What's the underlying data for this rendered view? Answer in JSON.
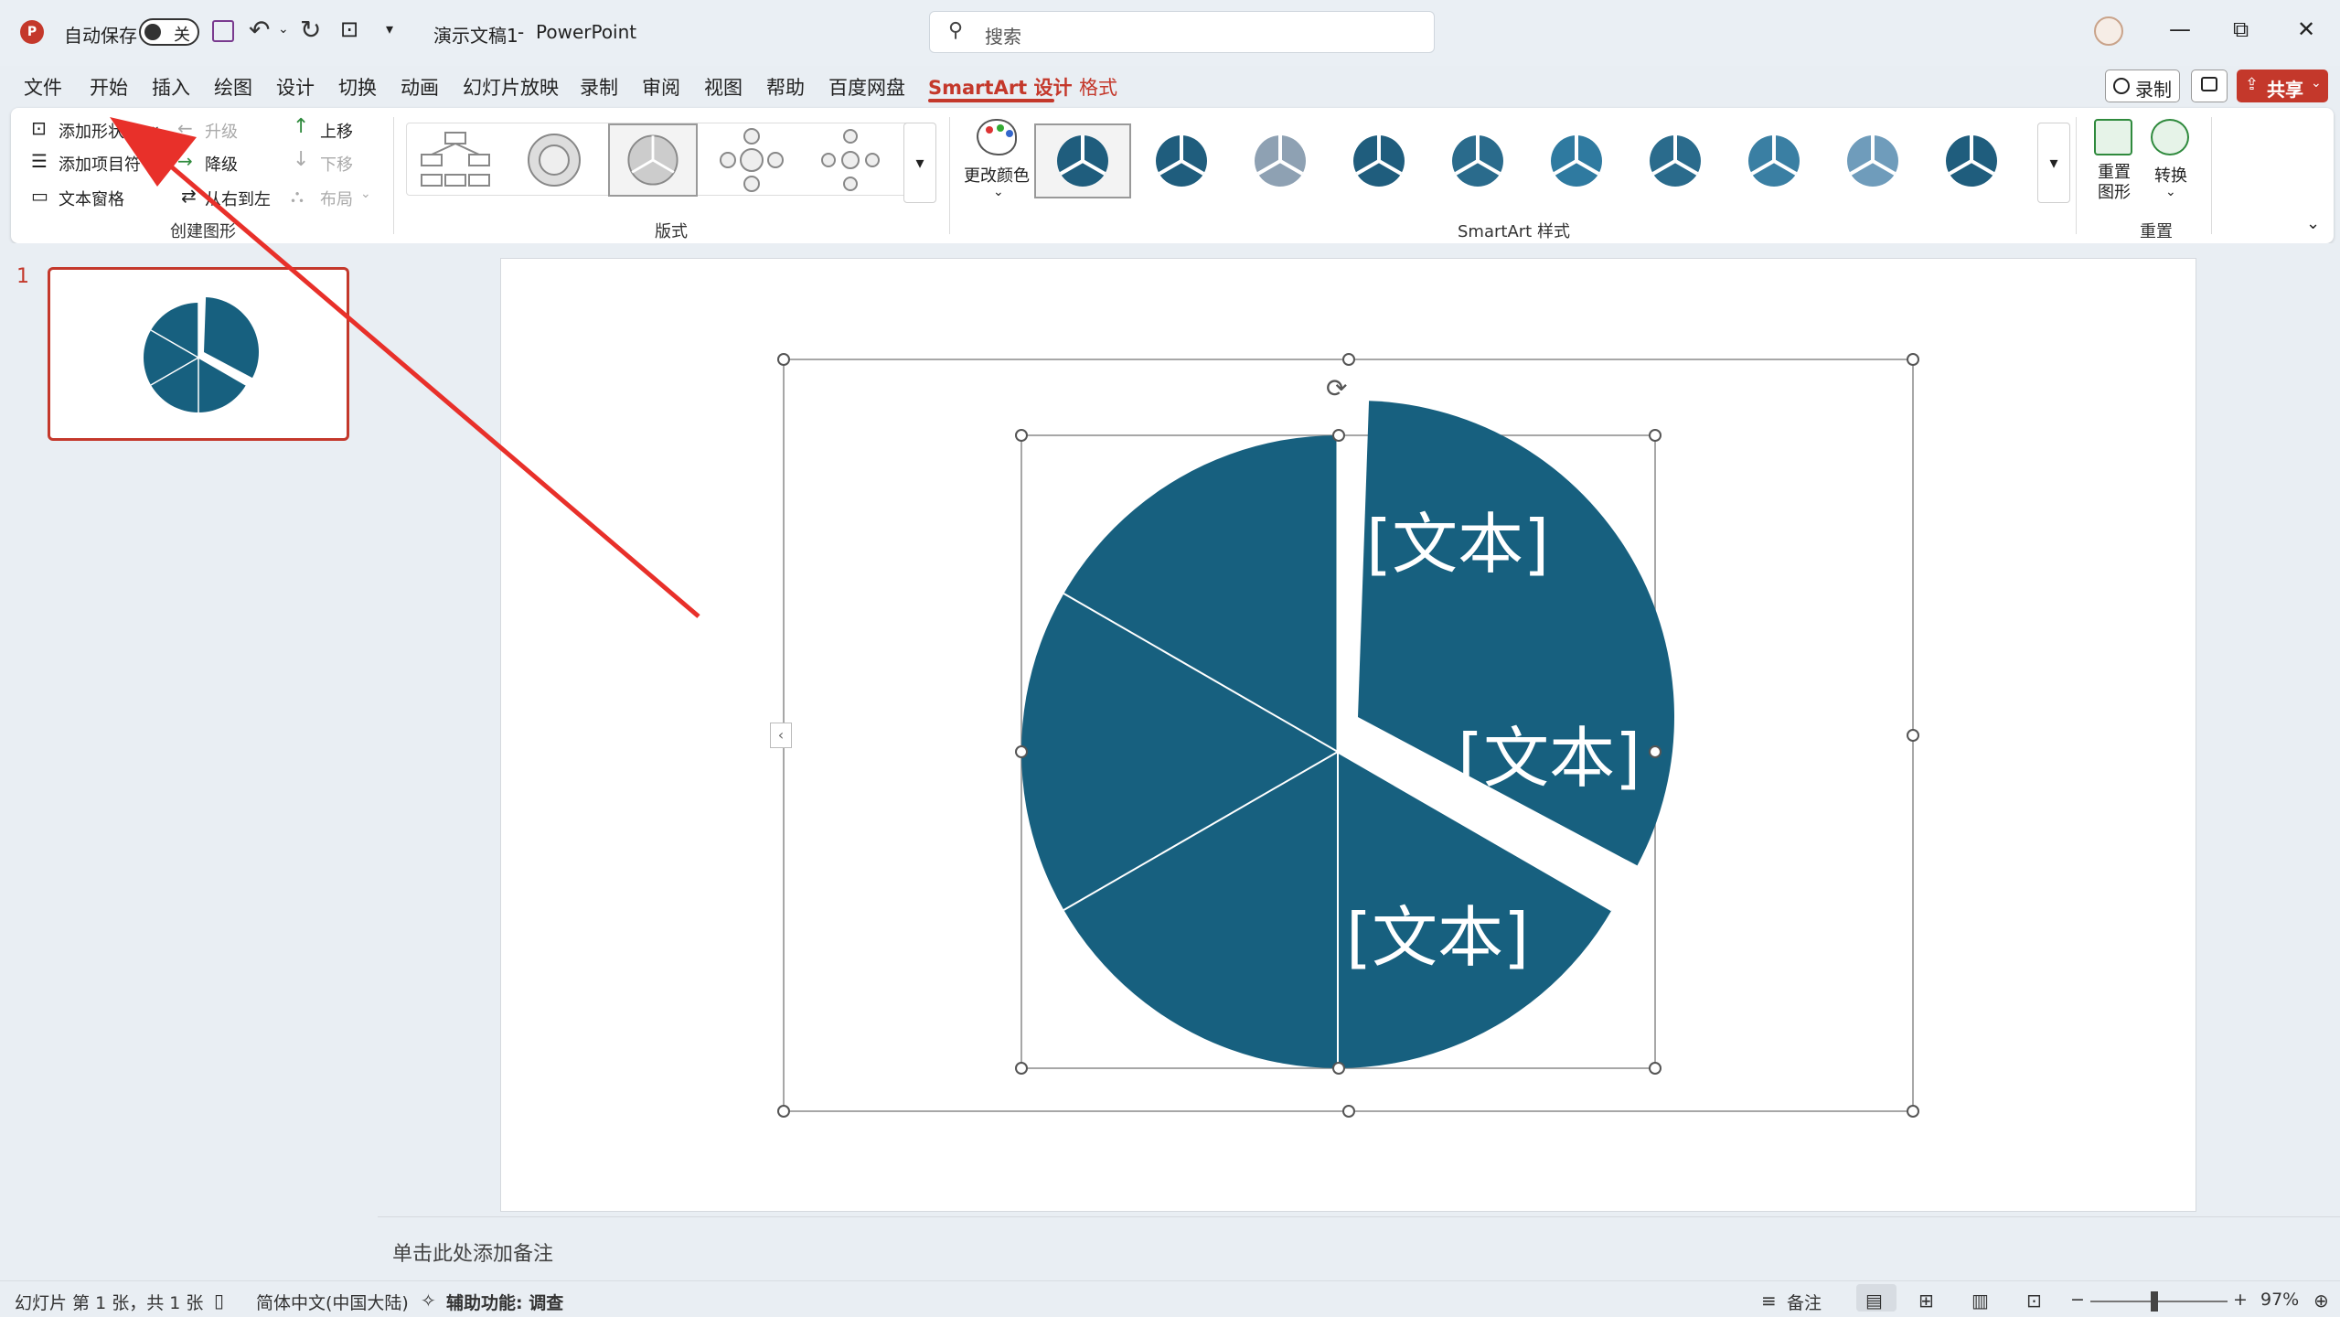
{
  "titlebar": {
    "autosave_label": "自动保存",
    "autosave_state": "关",
    "doc_title": "演示文稿1",
    "dash": "-",
    "app_name": "PowerPoint",
    "search_placeholder": "搜索"
  },
  "menu": {
    "items": [
      "文件",
      "开始",
      "插入",
      "绘图",
      "设计",
      "切换",
      "动画",
      "幻灯片放映",
      "录制",
      "审阅",
      "视图",
      "帮助",
      "百度网盘",
      "SmartArt 设计",
      "格式"
    ],
    "active": "SmartArt 设计",
    "record_label": "录制",
    "share_label": "共享"
  },
  "ribbon": {
    "create_group": {
      "add_shape": "添加形状",
      "add_bullet": "添加项目符号",
      "text_pane": "文本窗格",
      "promote": "升级",
      "demote": "降级",
      "rtl": "从右到左",
      "move_up": "上移",
      "move_down": "下移",
      "layout": "布局",
      "label": "创建图形"
    },
    "layouts_label": "版式",
    "change_colors": "更改颜色",
    "styles_label": "SmartArt 样式",
    "reset_graphic": "重置图形",
    "convert": "转换",
    "reset_label": "重置"
  },
  "slides": {
    "current_number": "1"
  },
  "smartart": {
    "segment_texts": [
      "[文本]",
      "[文本]",
      "[文本]"
    ],
    "fill_color": "#17607f"
  },
  "notes_placeholder": "单击此处添加备注",
  "status": {
    "slide_info": "幻灯片 第 1 张，共 1 张",
    "language": "简体中文(中国大陆)",
    "accessibility": "辅助功能: 调查",
    "notes_button": "备注",
    "zoom": "97%"
  },
  "colors": {
    "accent": "#c4382b",
    "chart_fill": "#17607f"
  }
}
